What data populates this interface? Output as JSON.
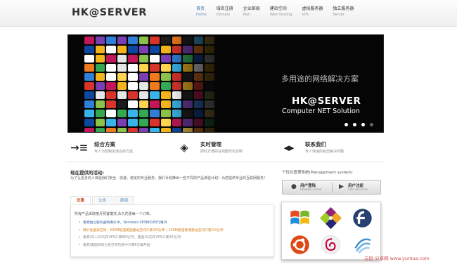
{
  "logo": "HK@SERVER",
  "nav": [
    {
      "cn": "首页",
      "en": "Home"
    },
    {
      "cn": "域名注册",
      "en": "Domain"
    },
    {
      "cn": "企业邮局",
      "en": "Mail"
    },
    {
      "cn": "建站空间",
      "en": "Web Hosting"
    },
    {
      "cn": "虚拟服务器",
      "en": "VPS"
    },
    {
      "cn": "独立服务器",
      "en": "Server"
    }
  ],
  "banner": {
    "slogan": "多用途的网络解决方案",
    "brand": "HK@SERVER",
    "subtitle": "Computer NET Solution",
    "slides": 4,
    "current_slide": 4
  },
  "features": [
    {
      "icon": "menu-list-icon",
      "glyph": "→≡",
      "title": "综合方案",
      "desc": "专人为您制定适合的方案"
    },
    {
      "icon": "layers-icon",
      "glyph": "◈",
      "title": "实时管理",
      "desc": "即时方便的在线图形化控制"
    },
    {
      "icon": "arrows-icon",
      "glyph": "◂▸",
      "title": "联系我们",
      "desc": "专人快速的给您解决问题"
    }
  ],
  "section": {
    "title": "现在提供的活动:",
    "intro": "为了让更多的人体验我们安全、快速、稳定的专业服务，我们计划推出一些不同的产品体验计划！为您提供专业的互联网服务！"
  },
  "tabs": [
    "优惠",
    "公告",
    "新闻"
  ],
  "active_tab": 0,
  "tab_content": {
    "heading": "所有产品采取按月预置模式,永久优惠每一个订单。",
    "items": [
      {
        "text": "香港独立服务器特惠价中，Windows VPS特价80元每月",
        "style": "blue"
      },
      {
        "text": "特价免备案空间：500M极速美国建站空间只要10元/年 | 100M极速香港建站空间只要20元/年",
        "style": "orange"
      },
      {
        "text": "香港2G+2G内存VPS只要80元/月，美国1G内存VPS只要30元/月",
        "style": "gray"
      },
      {
        "text": "香港/美国双核主机空间热销中只要6元每月起",
        "style": "gray"
      }
    ]
  },
  "sidebar": {
    "label": "个性化管理系统(Management system)",
    "login": {
      "title": "用户登陆",
      "sub": "MEMBER CENTER"
    },
    "register": {
      "title": "用户注册",
      "sub": "USER REGISTER"
    },
    "os_icons": [
      "windows-icon",
      "centos-icon",
      "fedora-icon",
      "ubuntu-icon",
      "debian-icon",
      "generic-linux-icon"
    ]
  },
  "watermark": "云层·分享网 www.yuntue.com",
  "colors": {
    "link_blue": "#3a77b7",
    "tab_active": "#d24a2b",
    "promo_orange": "#d37f1c",
    "banner_bg": "#050505"
  }
}
